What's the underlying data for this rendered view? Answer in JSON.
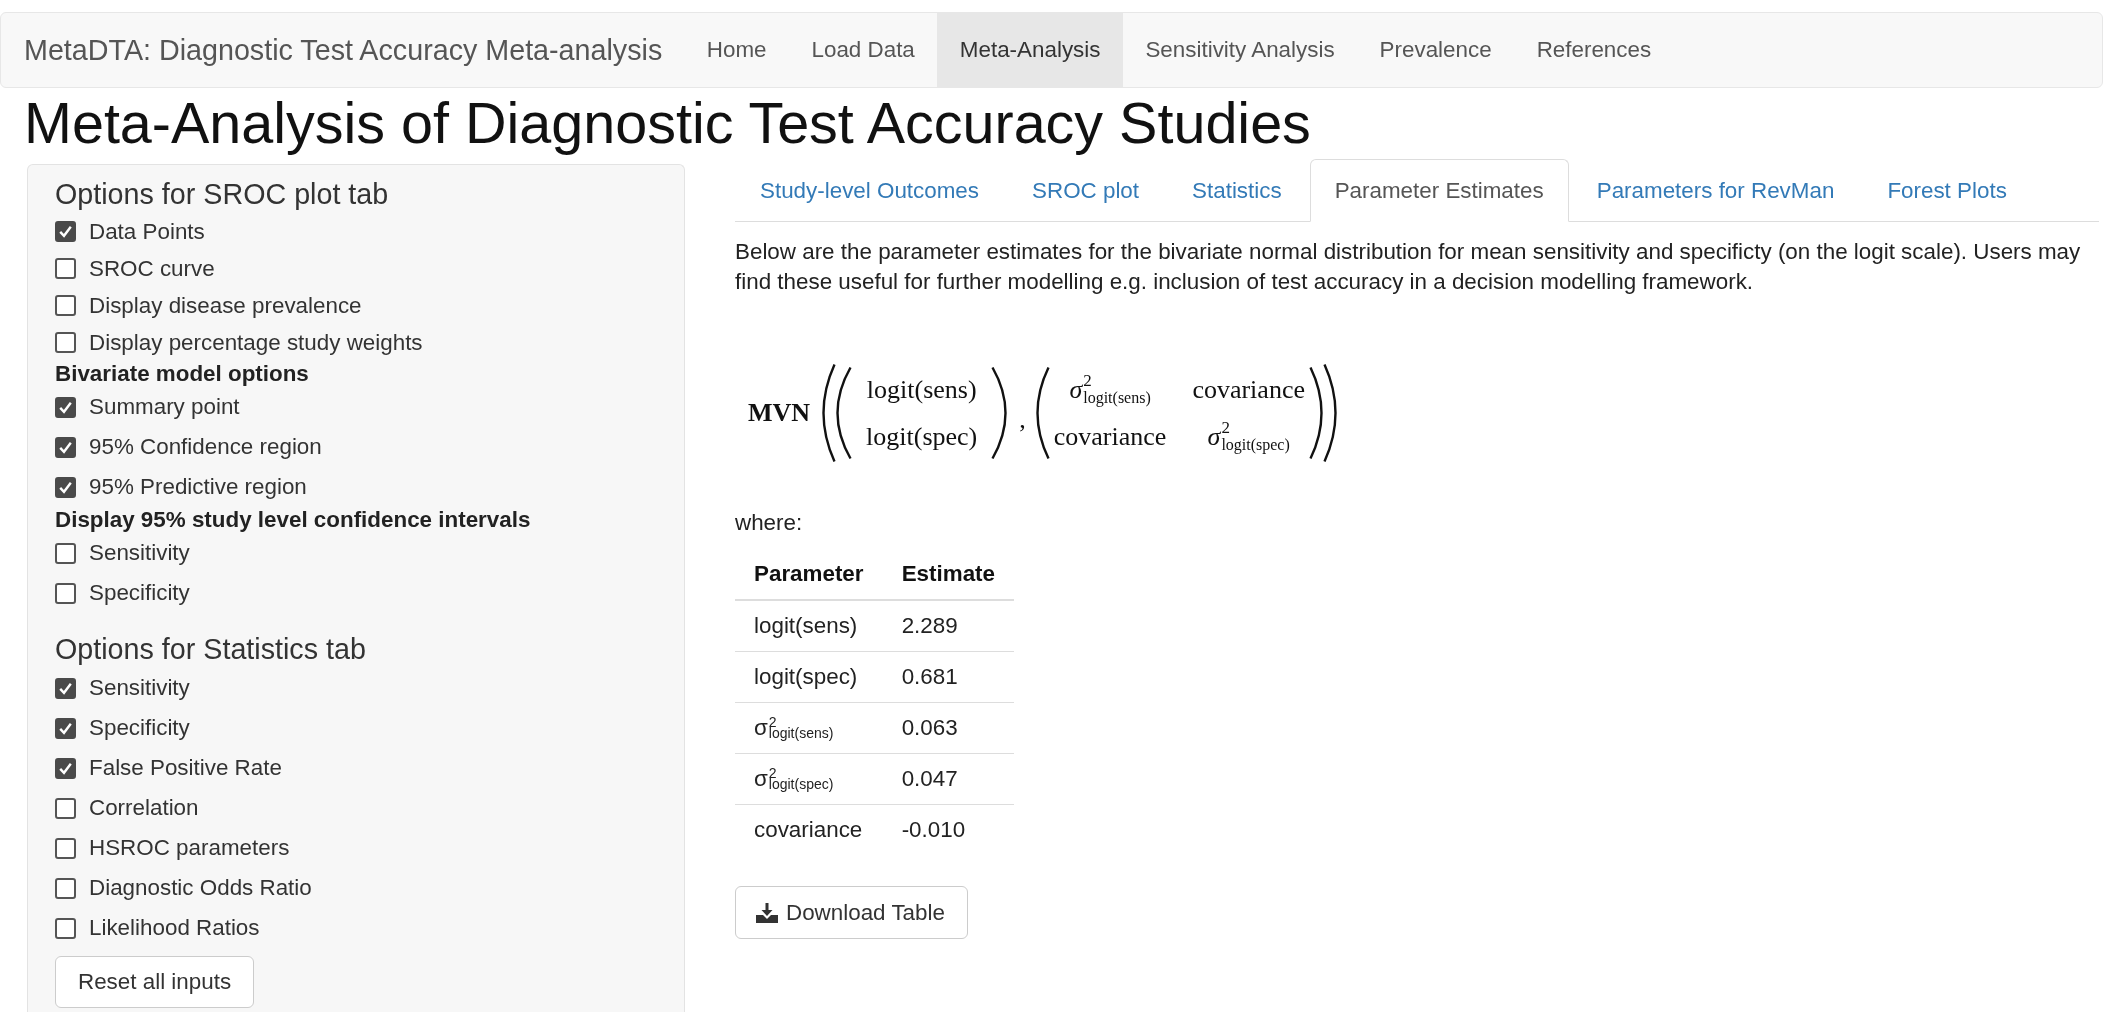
{
  "navbar": {
    "brand": "MetaDTA: Diagnostic Test Accuracy Meta-analysis",
    "items": [
      {
        "label": "Home",
        "selected": false
      },
      {
        "label": "Load Data",
        "selected": false
      },
      {
        "label": "Meta-Analysis",
        "selected": true
      },
      {
        "label": "Sensitivity Analysis",
        "selected": false
      },
      {
        "label": "Prevalence",
        "selected": false
      },
      {
        "label": "References",
        "selected": false
      }
    ]
  },
  "page_title": "Meta-Analysis of Diagnostic Test Accuracy Studies",
  "sidebar": {
    "sections": [
      {
        "title": "Options for SROC plot tab",
        "groups": [
          {
            "checkboxes": [
              {
                "label": "Data Points",
                "checked": true
              },
              {
                "label": "SROC curve",
                "checked": false
              },
              {
                "label": "Display disease prevalence",
                "checked": false
              },
              {
                "label": "Display percentage study weights",
                "checked": false
              }
            ]
          },
          {
            "heading": "Bivariate model options",
            "checkboxes": [
              {
                "label": "Summary point",
                "checked": true
              },
              {
                "label": "95% Confidence region",
                "checked": true
              },
              {
                "label": "95% Predictive region",
                "checked": true
              }
            ]
          },
          {
            "heading": "Display 95% study level confidence intervals",
            "checkboxes": [
              {
                "label": "Sensitivity",
                "checked": false
              },
              {
                "label": "Specificity",
                "checked": false
              }
            ]
          }
        ]
      },
      {
        "title": "Options for Statistics tab",
        "groups": [
          {
            "checkboxes": [
              {
                "label": "Sensitivity",
                "checked": true
              },
              {
                "label": "Specificity",
                "checked": true
              },
              {
                "label": "False Positive Rate",
                "checked": true
              },
              {
                "label": "Correlation",
                "checked": false
              },
              {
                "label": "HSROC parameters",
                "checked": false
              },
              {
                "label": "Diagnostic Odds Ratio",
                "checked": false
              },
              {
                "label": "Likelihood Ratios",
                "checked": false
              }
            ]
          }
        ]
      }
    ],
    "reset_button": "Reset all inputs"
  },
  "main": {
    "tabs": [
      {
        "label": "Study-level Outcomes",
        "selected": false
      },
      {
        "label": "SROC plot",
        "selected": false
      },
      {
        "label": "Statistics",
        "selected": false
      },
      {
        "label": "Parameter Estimates",
        "selected": true
      },
      {
        "label": "Parameters for RevMan",
        "selected": false
      },
      {
        "label": "Forest Plots",
        "selected": false
      }
    ],
    "description": "Below are the parameter estimates for the bivariate normal distribution for mean sensitivity and specificty (on the logit scale). Users may find these useful for further modelling e.g. inclusion of test accuracy in a decision modelling framework.",
    "formula": {
      "function": "MVN",
      "mean_vector": [
        "logit(sens)",
        "logit(spec)"
      ],
      "separator": ",",
      "covariance_matrix": [
        [
          {
            "kind": "variance",
            "symbol": "σ",
            "sup": "2",
            "sub": "logit(sens)"
          },
          {
            "kind": "text",
            "text": "covariance"
          }
        ],
        [
          {
            "kind": "text",
            "text": "covariance"
          },
          {
            "kind": "variance",
            "symbol": "σ",
            "sup": "2",
            "sub": "logit(spec)"
          }
        ]
      ]
    },
    "where_label": "where:",
    "table": {
      "columns": [
        "Parameter",
        "Estimate"
      ],
      "rows": [
        {
          "parameter": {
            "kind": "text",
            "text": "logit(sens)"
          },
          "estimate": "2.289"
        },
        {
          "parameter": {
            "kind": "text",
            "text": "logit(spec)"
          },
          "estimate": "0.681"
        },
        {
          "parameter": {
            "kind": "variance",
            "symbol": "σ",
            "sup": "2",
            "sub": "logit(sens)"
          },
          "estimate": "0.063"
        },
        {
          "parameter": {
            "kind": "variance",
            "symbol": "σ",
            "sup": "2",
            "sub": "logit(spec)"
          },
          "estimate": "0.047"
        },
        {
          "parameter": {
            "kind": "text",
            "text": "covariance"
          },
          "estimate": "-0.010"
        }
      ]
    },
    "download_button": "Download Table"
  }
}
